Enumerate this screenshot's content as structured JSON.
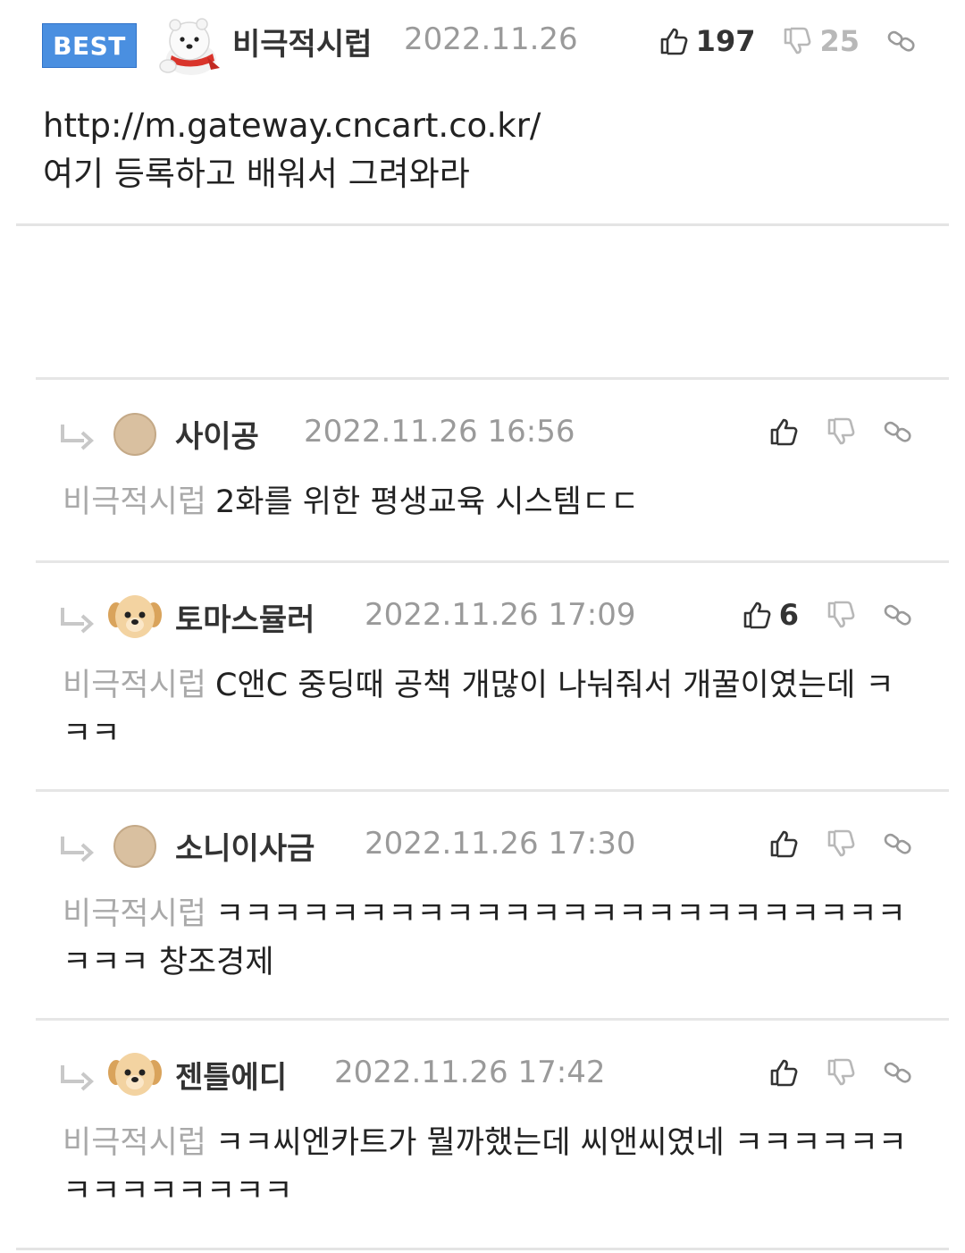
{
  "best": {
    "badge": "BEST",
    "author": "비극적시럽",
    "date": "2022.11.26",
    "likes": "197",
    "dislikes": "25",
    "body_line1": "http://m.gateway.cncart.co.kr/",
    "body_line2": "여기 등록하고 배워서 그려와라"
  },
  "replies": [
    {
      "author": "사이공",
      "date": "2022.11.26 16:56",
      "likes": "",
      "mention": "비극적시럽",
      "text": "2화를 위한 평생교육 시스템ㄷㄷ",
      "avatar": "default-avatar"
    },
    {
      "author": "토마스뮬러",
      "date": "2022.11.26 17:09",
      "likes": "6",
      "mention": "비극적시럽",
      "text": "C앤C 중딩때 공책 개많이 나눠줘서 개꿀이였는데 ㅋㅋㅋ",
      "avatar": "puppy-avatar"
    },
    {
      "author": "소니이사금",
      "date": "2022.11.26 17:30",
      "likes": "",
      "mention": "비극적시럽",
      "text": "ㅋㅋㅋㅋㅋㅋㅋㅋㅋㅋㅋㅋㅋㅋㅋㅋㅋㅋㅋㅋㅋㅋㅋㅋㅋㅋㅋ 창조경제",
      "avatar": "default-avatar"
    },
    {
      "author": "젠틀에디",
      "date": "2022.11.26 17:42",
      "likes": "",
      "mention": "비극적시럽",
      "text": "ㅋㅋ씨엔카트가 뭘까했는데 씨앤씨였네 ㅋㅋㅋㅋㅋㅋㅋㅋㅋㅋㅋㅋㅋㅋ",
      "avatar": "puppy-avatar"
    }
  ],
  "colors": {
    "best_badge": "#4a8fe0",
    "meta_gray": "#9a9a9a",
    "mention_gray": "#a9a9a9"
  }
}
